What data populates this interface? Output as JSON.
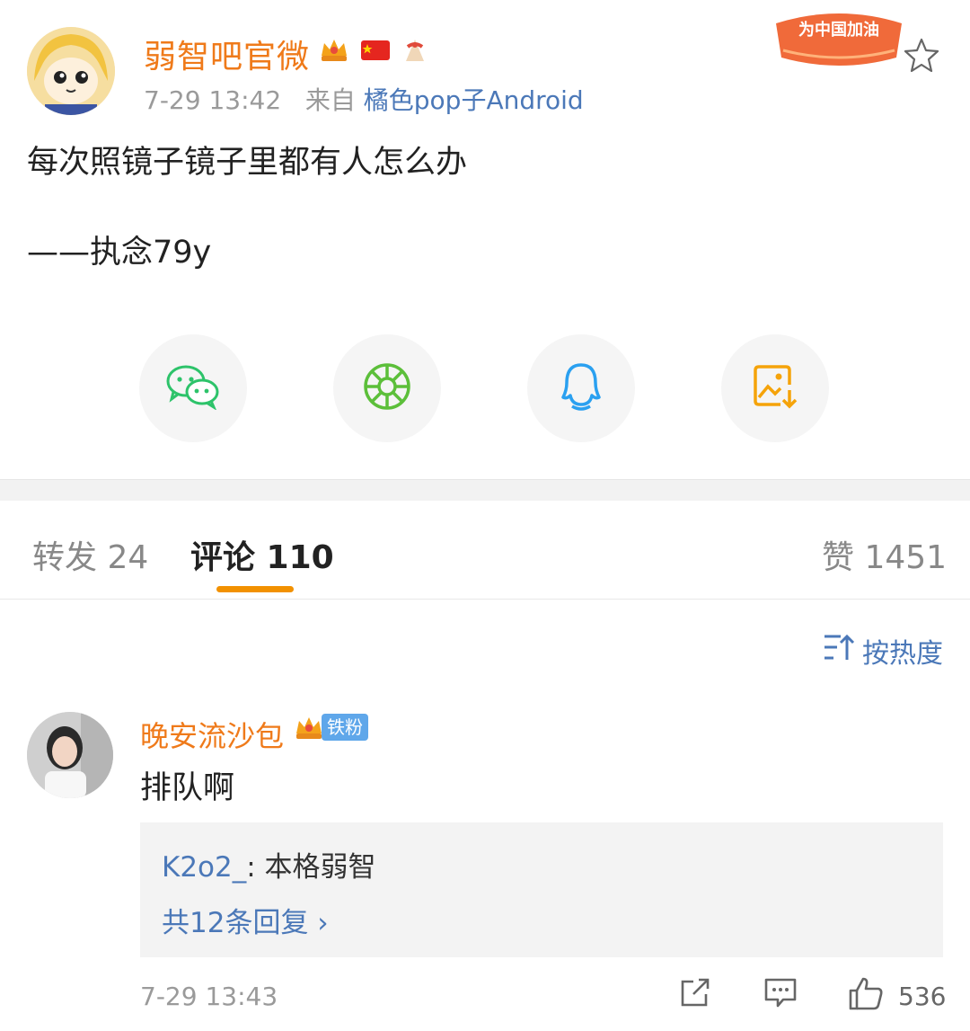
{
  "post": {
    "author": "弱智吧官微",
    "timestamp": "7-29 13:42",
    "from_label": "来自",
    "source": "橘色pop子Android",
    "banner_text": "为中国加油",
    "content_line1": "每次照镜子镜子里都有人怎么办",
    "content_line2": "——执念79y"
  },
  "share": {
    "icons": [
      "wechat-icon",
      "moments-icon",
      "qq-icon",
      "save-image-icon"
    ]
  },
  "tabs": {
    "repost": "转发 24",
    "comments": "评论 110",
    "likes": "赞 1451"
  },
  "sort": {
    "label": "按热度"
  },
  "comment": {
    "author": "晚安流沙包",
    "fan_badge": "铁粉",
    "text": "排队啊",
    "reply_author": "K2o2_",
    "reply_sep": ":",
    "reply_text": " 本格弱智",
    "reply_more": "共12条回复 ›",
    "timestamp": "7-29 13:43",
    "likes": "536"
  },
  "colors": {
    "accent_orange": "#ef7a1a",
    "link_blue": "#4b78b8",
    "tab_underline": "#f29100"
  }
}
